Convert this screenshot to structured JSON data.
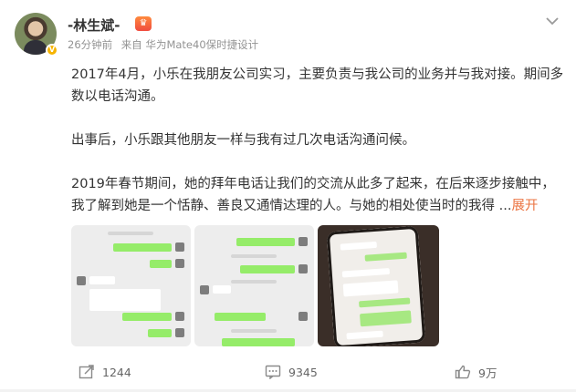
{
  "user": {
    "name": "-林生斌-",
    "verified_badge": "V",
    "member_icon": "vip-crown-icon",
    "avatar_icon": "avatar-image"
  },
  "meta": {
    "time": "26分钟前",
    "source": "来自 华为Mate40保时捷设计"
  },
  "post": {
    "paragraphs": [
      "2017年4月，小乐在我朋友公司实习，主要负责与我公司的业务并与我对接。期间多数以电话沟通。",
      "出事后，小乐跟其他朋友一样与我有过几次电话沟通问候。",
      "2019年春节期间，她的拜年电话让我们的交流从此多了起来，在后来逐步接触中，我了解到她是一个恬静、善良又通情达理的人。与她的相处使当时的我得"
    ],
    "ellipsis": "...",
    "expand_label": "展开"
  },
  "images": [
    {
      "name": "chat-screenshot-1"
    },
    {
      "name": "chat-screenshot-2"
    },
    {
      "name": "phone-photo"
    }
  ],
  "actions": {
    "repost_count": "1244",
    "comment_count": "9345",
    "like_count": "9万"
  },
  "colors": {
    "accent": "#eb7340",
    "badge": "#f6b400",
    "meta_text": "#939393",
    "wechat_green": "#95ec69"
  }
}
